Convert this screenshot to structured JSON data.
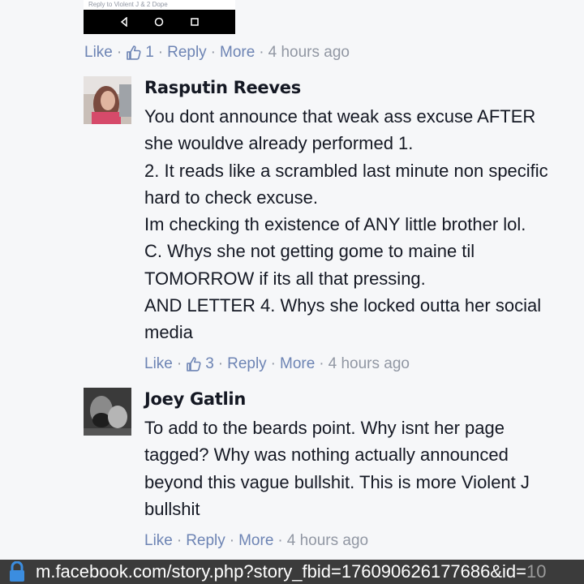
{
  "thumbnail": {
    "reply_text": "Reply to Violent J & 2 Dope",
    "nav_icons": [
      "back-icon",
      "home-icon",
      "recents-icon"
    ]
  },
  "first_actions": {
    "like": "Like",
    "like_count": "1",
    "reply": "Reply",
    "more": "More",
    "time": "4 hours ago"
  },
  "comments": [
    {
      "author": "Rasputin Reeves",
      "lines": [
        "You dont announce that weak ass excuse AFTER",
        "she wouldve already performed 1.",
        "2. It reads like a scrambled last minute non specific",
        "hard to check excuse.",
        "Im checking th existence of ANY little brother lol.",
        "C. Whys she not getting gome to maine til",
        "TOMORROW if its all that pressing.",
        "AND LETTER 4. Whys she locked outta her social",
        "media"
      ],
      "like": "Like",
      "like_count": "3",
      "reply": "Reply",
      "more": "More",
      "time": "4 hours ago"
    },
    {
      "author": "Joey Gatlin",
      "lines": [
        "To add to the beards point. Why isnt her page",
        "tagged? Why was nothing actually announced",
        "beyond this vague bullshit. This is more Violent J",
        "bullshit"
      ],
      "like": "Like",
      "reply": "Reply",
      "more": "More",
      "time": "4 hours ago"
    }
  ],
  "url_bar": {
    "url_main": "m.facebook.com/story.php?story_fbid=176090626177686&id=",
    "url_faded": "10"
  },
  "colors": {
    "link": "#6d84b4",
    "muted": "#9197a3",
    "text": "#141823",
    "background": "#f6f7f9"
  }
}
